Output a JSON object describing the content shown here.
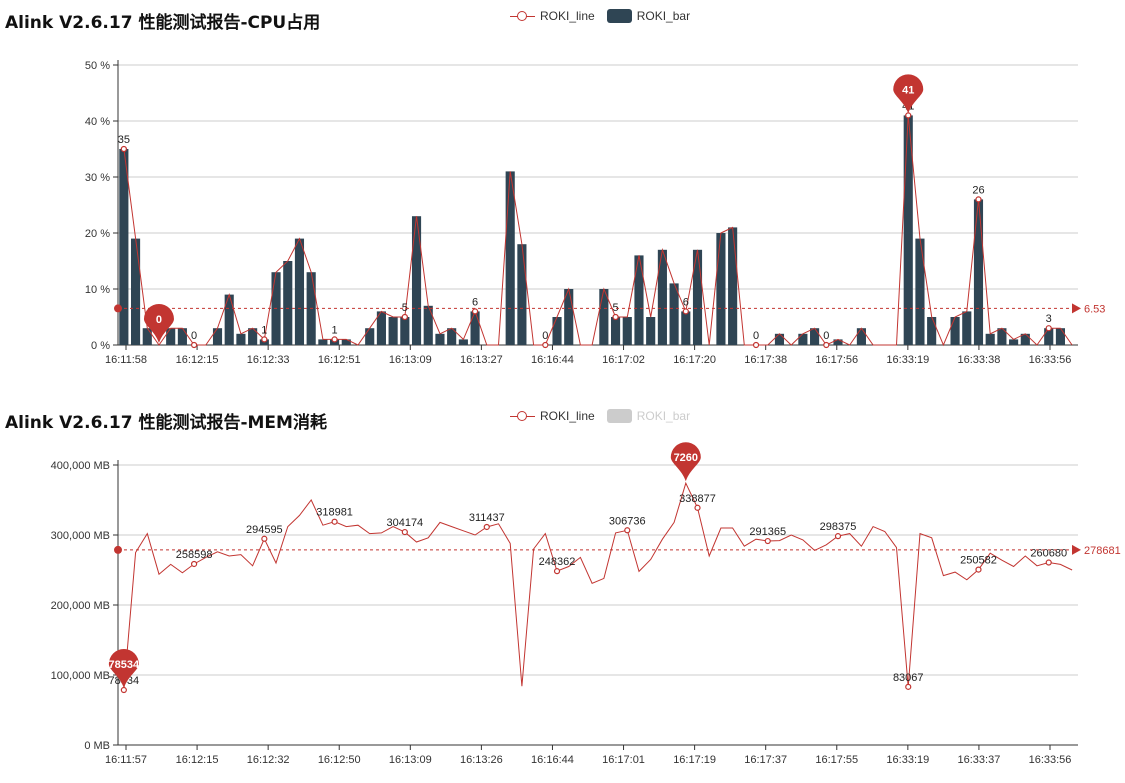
{
  "colors": {
    "line": "#c23531",
    "bar": "#2f4554",
    "grid": "#cccccc",
    "axis": "#333333",
    "legend_off": "#cccccc"
  },
  "chart_data": [
    {
      "id": "cpu",
      "type": "bar+line",
      "title": "Alink V2.6.17 性能测试报告-CPU占用",
      "legend": [
        "ROKI_line",
        "ROKI_bar"
      ],
      "legend_off": [],
      "ylim": [
        0,
        50
      ],
      "y_ticks": [
        "0 %",
        "10 %",
        "20 %",
        "30 %",
        "40 %",
        "50 %"
      ],
      "y_tick_values": [
        0,
        10,
        20,
        30,
        40,
        50
      ],
      "x_tick_labels": [
        "16:11:58",
        "16:12:15",
        "16:12:33",
        "16:12:51",
        "16:13:09",
        "16:13:27",
        "16:16:44",
        "16:17:02",
        "16:17:20",
        "16:17:38",
        "16:17:56",
        "16:33:19",
        "16:33:38",
        "16:33:56"
      ],
      "series": [
        {
          "name": "ROKI_bar",
          "kind": "bar",
          "values": [
            35,
            19,
            3,
            0,
            3,
            3,
            0,
            0,
            3,
            9,
            2,
            3,
            1,
            13,
            15,
            19,
            13,
            1,
            1,
            1,
            0,
            3,
            6,
            5,
            5,
            23,
            7,
            2,
            3,
            1,
            6,
            0,
            0,
            31,
            18,
            0,
            0,
            5,
            10,
            0,
            0,
            10,
            5,
            5,
            16,
            5,
            17,
            11,
            6,
            17,
            0,
            20,
            21,
            0,
            0,
            0,
            2,
            0,
            2,
            3,
            0,
            1,
            0,
            3,
            0,
            0,
            0,
            41,
            19,
            5,
            0,
            5,
            6,
            26,
            2,
            3,
            1,
            2,
            0,
            3,
            3,
            0
          ]
        },
        {
          "name": "ROKI_line",
          "kind": "line",
          "values": [
            35,
            19,
            3,
            0,
            3,
            3,
            0,
            0,
            3,
            9,
            2,
            3,
            1,
            13,
            15,
            19,
            13,
            1,
            1,
            1,
            0,
            3,
            6,
            5,
            5,
            23,
            7,
            2,
            3,
            1,
            6,
            0,
            0,
            31,
            18,
            0,
            0,
            5,
            10,
            0,
            0,
            10,
            5,
            5,
            16,
            5,
            17,
            11,
            6,
            17,
            0,
            20,
            21,
            0,
            0,
            0,
            2,
            0,
            2,
            3,
            0,
            1,
            0,
            3,
            0,
            0,
            0,
            41,
            19,
            5,
            0,
            5,
            6,
            26,
            2,
            3,
            1,
            2,
            0,
            3,
            3,
            0
          ],
          "labeled_points": [
            [
              0,
              "35"
            ],
            [
              6,
              "0"
            ],
            [
              12,
              "1"
            ],
            [
              18,
              "1"
            ],
            [
              24,
              "5"
            ],
            [
              30,
              "6"
            ],
            [
              36,
              "0"
            ],
            [
              42,
              "5"
            ],
            [
              48,
              "6"
            ],
            [
              54,
              "0"
            ],
            [
              60,
              "0"
            ],
            [
              67,
              "41"
            ],
            [
              73,
              "26"
            ],
            [
              79,
              "3"
            ]
          ],
          "max_pin": {
            "index": 67,
            "label": "41"
          },
          "min_pin": {
            "index": 3,
            "label": "0"
          },
          "average": {
            "value": 6.53,
            "label": "6.53"
          }
        }
      ]
    },
    {
      "id": "mem",
      "type": "line",
      "title": "Alink V2.6.17 性能测试报告-MEM消耗",
      "legend": [
        "ROKI_line",
        "ROKI_bar"
      ],
      "legend_off": [
        "ROKI_bar"
      ],
      "ylim": [
        0,
        400000
      ],
      "y_ticks": [
        "0 MB",
        "100,000 MB",
        "200,000 MB",
        "300,000 MB",
        "400,000 MB"
      ],
      "y_tick_values": [
        0,
        100000,
        200000,
        300000,
        400000
      ],
      "x_tick_labels": [
        "16:11:57",
        "16:12:15",
        "16:12:32",
        "16:12:50",
        "16:13:09",
        "16:13:26",
        "16:16:44",
        "16:17:01",
        "16:17:19",
        "16:17:37",
        "16:17:55",
        "16:33:19",
        "16:33:37",
        "16:33:56"
      ],
      "series": [
        {
          "name": "ROKI_line",
          "kind": "line",
          "values": [
            78534,
            275000,
            302000,
            244000,
            258000,
            246000,
            258598,
            268000,
            276000,
            270000,
            272000,
            256000,
            294595,
            260000,
            312000,
            328000,
            350000,
            314000,
            318981,
            312000,
            314000,
            302000,
            303000,
            312000,
            304174,
            290000,
            296000,
            318000,
            312000,
            306000,
            300000,
            311437,
            316000,
            288000,
            84000,
            280000,
            302000,
            248362,
            255000,
            268000,
            231000,
            238000,
            303000,
            306736,
            248000,
            265000,
            294000,
            318000,
            374000,
            338877,
            270000,
            310000,
            310000,
            284000,
            294000,
            291365,
            292000,
            300000,
            293000,
            278000,
            286000,
            298375,
            302000,
            284000,
            312000,
            305000,
            282000,
            83067,
            302000,
            296000,
            242000,
            247000,
            236000,
            250582,
            274000,
            264000,
            255000,
            270000,
            256000,
            260680,
            258000,
            250000
          ],
          "labeled_points": [
            [
              0,
              "78534"
            ],
            [
              6,
              "258598"
            ],
            [
              12,
              "294595"
            ],
            [
              18,
              "318981"
            ],
            [
              24,
              "304174"
            ],
            [
              31,
              "311437"
            ],
            [
              37,
              "248362"
            ],
            [
              43,
              "306736"
            ],
            [
              49,
              "338877"
            ],
            [
              55,
              "291365"
            ],
            [
              61,
              "298375"
            ],
            [
              67,
              "83067"
            ],
            [
              73,
              "250582"
            ],
            [
              79,
              "260680"
            ]
          ],
          "max_pin": {
            "index": 48,
            "label": "7260"
          },
          "min_pin": {
            "index": 0,
            "label": "78534"
          },
          "average": {
            "value": 278681,
            "label": "278681"
          }
        }
      ]
    }
  ]
}
